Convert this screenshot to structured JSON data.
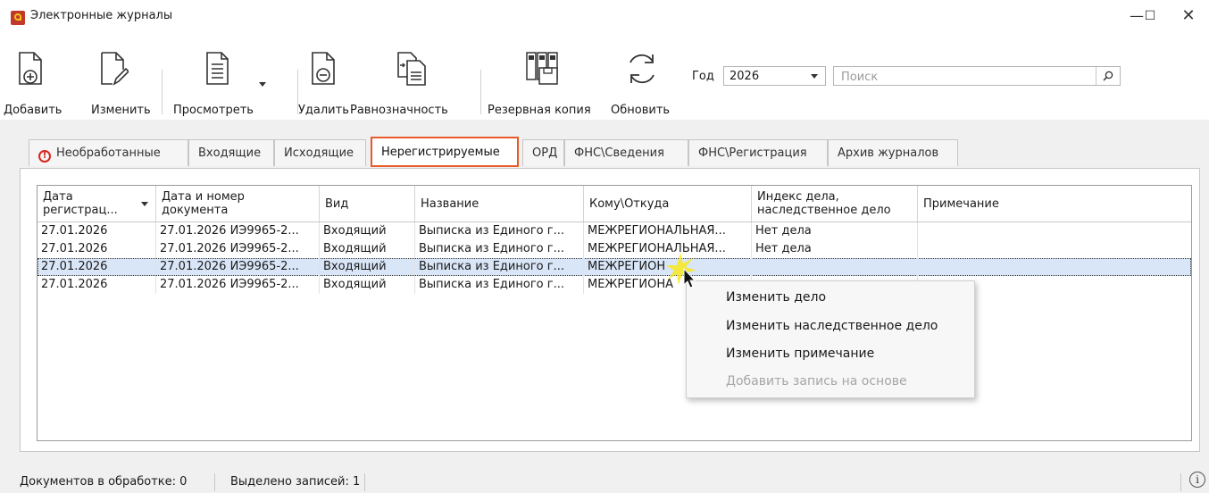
{
  "window": {
    "title": "Электронные журналы",
    "controls": {
      "minimize": "—",
      "maximize": "☐",
      "close": "✕"
    }
  },
  "toolbar": {
    "add": "Добавить",
    "edit": "Изменить",
    "view": "Просмотреть",
    "delete": "Удалить",
    "equivalence": "Равнозначность",
    "backup": "Резервная копия",
    "refresh": "Обновить",
    "year_label": "Год",
    "year_value": "2026",
    "search_placeholder": "Поиск",
    "icons": [
      "add-document-icon",
      "edit-document-icon",
      "view-document-icon",
      "delete-document-icon",
      "equivalence-icon",
      "backup-icon",
      "refresh-icon",
      "search-icon"
    ]
  },
  "tabs": [
    {
      "label": "Необработанные",
      "icon": "warning-icon",
      "active": false
    },
    {
      "label": "Входящие",
      "active": false
    },
    {
      "label": "Исходящие",
      "active": false
    },
    {
      "label": "Нерегистрируемые",
      "active": true
    },
    {
      "label": "ОРД",
      "active": false
    },
    {
      "label": "ФНС\\Сведения",
      "active": false
    },
    {
      "label": "ФНС\\Регистрация",
      "active": false
    },
    {
      "label": "Архив журналов",
      "active": false
    }
  ],
  "table": {
    "columns": [
      "Дата регистрац...",
      "Дата и номер документа",
      "Вид",
      "Название",
      "Кому\\Откуда",
      "Индекс дела, наследственное дело",
      "Примечание"
    ],
    "rows": [
      [
        "27.01.2026",
        "27.01.2026 ИЭ9965-2...",
        "Входящий",
        "Выписка из Единого г...",
        "МЕЖРЕГИОНАЛЬНАЯ...",
        "Нет дела",
        ""
      ],
      [
        "27.01.2026",
        "27.01.2026 ИЭ9965-2...",
        "Входящий",
        "Выписка из Единого г...",
        "МЕЖРЕГИОНАЛЬНАЯ...",
        "Нет дела",
        ""
      ],
      [
        "27.01.2026",
        "27.01.2026 ИЭ9965-2...",
        "Входящий",
        "Выписка из Единого г...",
        "МЕЖРЕГИОН",
        "",
        ""
      ],
      [
        "27.01.2026",
        "27.01.2026 ИЭ9965-2...",
        "Входящий",
        "Выписка из Единого г...",
        "МЕЖРЕГИОНА",
        "",
        ""
      ]
    ],
    "selected_row": 2
  },
  "context_menu": {
    "items": [
      {
        "label": "Изменить дело",
        "enabled": true
      },
      {
        "label": "Изменить наследственное дело",
        "enabled": true
      },
      {
        "label": "Изменить примечание",
        "enabled": true
      },
      {
        "label": "Добавить запись на основе",
        "enabled": false
      }
    ]
  },
  "status": {
    "in_processing": "Документов в обработке: 0",
    "selected": "Выделено записей: 1",
    "info_icon": "ⓘ"
  },
  "colors": {
    "active_tab_border": "#e85a2a",
    "selection": "#d9e6f7",
    "warning": "#d9261c"
  }
}
